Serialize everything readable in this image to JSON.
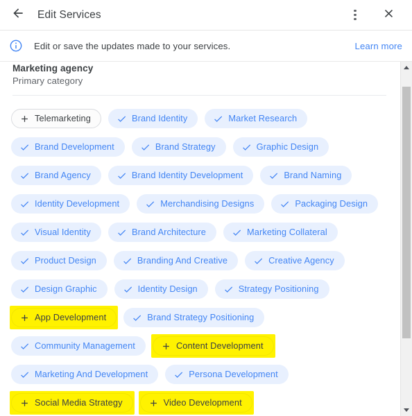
{
  "header": {
    "back_icon": "arrow-left-icon",
    "title": "Edit Services",
    "menu_icon": "more-vert-icon",
    "close_icon": "close-icon"
  },
  "banner": {
    "icon": "info-icon",
    "message": "Edit or save the updates made to your services.",
    "link_label": "Learn more"
  },
  "category": {
    "name": "Marketing agency",
    "subtitle": "Primary category"
  },
  "scrollbar": {
    "up_arrow_icon": "caret-up-icon",
    "down_arrow_icon": "caret-down-icon",
    "thumb_top_pct": 4,
    "thumb_height_pct": 76
  },
  "colors": {
    "accent_blue": "#4285f4",
    "chip_selected_bg": "#e8f0fe",
    "chip_text_selected": "#4285f4",
    "chip_unselected_bg": "#fcfcfc",
    "chip_unselected_border": "#dadce0",
    "highlight_yellow": "#fff200",
    "text_primary": "#3c4043",
    "text_secondary": "#5f6368"
  },
  "chip_rows": [
    [
      {
        "label": "Telemarketing",
        "state": "unselected",
        "icon": "plus-icon",
        "highlighted": false
      },
      {
        "label": "Brand Identity",
        "state": "selected",
        "icon": "check-icon",
        "highlighted": false
      },
      {
        "label": "Market Research",
        "state": "selected",
        "icon": "check-icon",
        "highlighted": false
      }
    ],
    [
      {
        "label": "Brand Development",
        "state": "selected",
        "icon": "check-icon",
        "highlighted": false
      },
      {
        "label": "Brand Strategy",
        "state": "selected",
        "icon": "check-icon",
        "highlighted": false
      },
      {
        "label": "Graphic Design",
        "state": "selected",
        "icon": "check-icon",
        "highlighted": false
      }
    ],
    [
      {
        "label": "Brand Agency",
        "state": "selected",
        "icon": "check-icon",
        "highlighted": false
      },
      {
        "label": "Brand Identity Development",
        "state": "selected",
        "icon": "check-icon",
        "highlighted": false
      },
      {
        "label": "Brand Naming",
        "state": "selected",
        "icon": "check-icon",
        "highlighted": false
      }
    ],
    [
      {
        "label": "Identity Development",
        "state": "selected",
        "icon": "check-icon",
        "highlighted": false
      },
      {
        "label": "Merchandising Designs",
        "state": "selected",
        "icon": "check-icon",
        "highlighted": false
      },
      {
        "label": "Packaging Design",
        "state": "selected",
        "icon": "check-icon",
        "highlighted": false
      }
    ],
    [
      {
        "label": "Visual Identity",
        "state": "selected",
        "icon": "check-icon",
        "highlighted": false
      },
      {
        "label": "Brand Architecture",
        "state": "selected",
        "icon": "check-icon",
        "highlighted": false
      },
      {
        "label": "Marketing Collateral",
        "state": "selected",
        "icon": "check-icon",
        "highlighted": false
      }
    ],
    [
      {
        "label": "Product Design",
        "state": "selected",
        "icon": "check-icon",
        "highlighted": false
      },
      {
        "label": "Branding And Creative",
        "state": "selected",
        "icon": "check-icon",
        "highlighted": false
      },
      {
        "label": "Creative Agency",
        "state": "selected",
        "icon": "check-icon",
        "highlighted": false
      }
    ],
    [
      {
        "label": "Design Graphic",
        "state": "selected",
        "icon": "check-icon",
        "highlighted": false
      },
      {
        "label": "Identity Design",
        "state": "selected",
        "icon": "check-icon",
        "highlighted": false
      },
      {
        "label": "Strategy Positioning",
        "state": "selected",
        "icon": "check-icon",
        "highlighted": false
      }
    ],
    [
      {
        "label": "App Development",
        "state": "unselected",
        "icon": "plus-icon",
        "highlighted": true
      },
      {
        "label": "Brand Strategy Positioning",
        "state": "selected",
        "icon": "check-icon",
        "highlighted": false
      }
    ],
    [
      {
        "label": "Community Management",
        "state": "selected",
        "icon": "check-icon",
        "highlighted": false
      },
      {
        "label": "Content Development",
        "state": "unselected",
        "icon": "plus-icon",
        "highlighted": true
      }
    ],
    [
      {
        "label": "Marketing And Development",
        "state": "selected",
        "icon": "check-icon",
        "highlighted": false
      },
      {
        "label": "Persona Development",
        "state": "selected",
        "icon": "check-icon",
        "highlighted": false
      }
    ],
    [
      {
        "label": "Social Media Strategy",
        "state": "unselected",
        "icon": "plus-icon",
        "highlighted": true
      },
      {
        "label": "Video Development",
        "state": "unselected",
        "icon": "plus-icon",
        "highlighted": true
      }
    ]
  ]
}
